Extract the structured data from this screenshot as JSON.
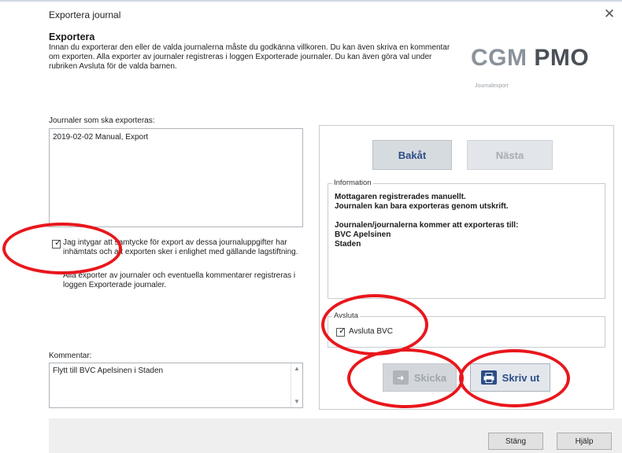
{
  "window": {
    "title": "Exportera journal",
    "close_glyph": "✕",
    "close_icon": "close-icon"
  },
  "header": {
    "heading": "Exportera",
    "intro": "Innan du exporterar den eller de valda journalerna måste du godkänna villkoren. Du kan även skriva en kommentar om exporten. Alla exporter av journaler registreras i loggen Exporterade journaler. Du kan även göra val under rubriken Avsluta för de valda barnen."
  },
  "logo": {
    "brand": "CGM",
    "product": "PMO",
    "subtitle": "Journalexport"
  },
  "journals": {
    "label": "Journaler som ska exporteras:",
    "items": [
      "2019-02-02 Manual, Export"
    ]
  },
  "consent": {
    "checked": true,
    "check_glyph": "✓",
    "text": "Jag intygar att samtycke för export av dessa journaluppgifter har inhämtats och att exporten sker i enlighet med gällande lagstiftning.",
    "note": "Alla exporter av journaler och eventuella kommentarer registreras i loggen Exporterade journaler."
  },
  "comment": {
    "label": "Kommentar:",
    "value": "Flytt till BVC Apelsinen i Staden"
  },
  "nav": {
    "back": "Bakåt",
    "next": "Nästa",
    "next_enabled": false
  },
  "information": {
    "label": "Information",
    "lines": [
      "Mottagaren registrerades manuellt.",
      "Journalen kan bara exporteras genom utskrift.",
      "",
      "Journalen/journalerna kommer att exporteras till:",
      "BVC Apelsinen",
      "Staden"
    ]
  },
  "avsluta": {
    "label": "Avsluta",
    "option": "Avsluta BVC",
    "checked": true
  },
  "actions": {
    "send": "Skicka",
    "send_enabled": false,
    "print": "Skriv ut"
  },
  "footer": {
    "close": "Stäng",
    "help": "Hjälp"
  },
  "colors": {
    "accent": "#2d4d86",
    "highlight": "#e8171c",
    "disabled": "#a7adb3"
  }
}
